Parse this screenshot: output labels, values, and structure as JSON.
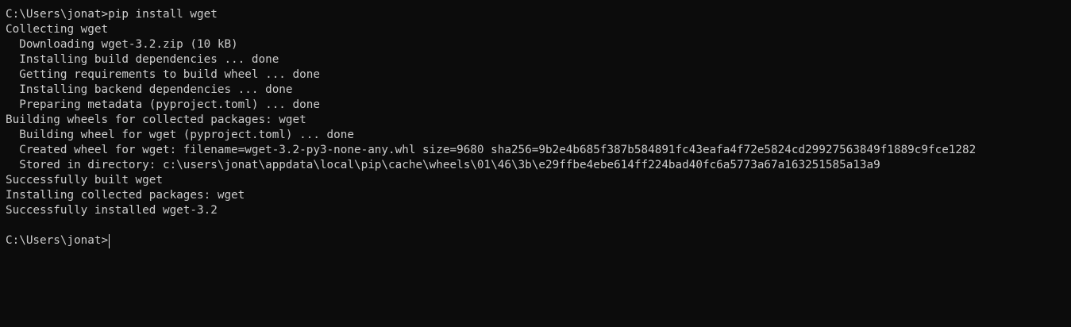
{
  "terminal": {
    "lines": [
      "C:\\Users\\jonat>pip install wget",
      "Collecting wget",
      "  Downloading wget-3.2.zip (10 kB)",
      "  Installing build dependencies ... done",
      "  Getting requirements to build wheel ... done",
      "  Installing backend dependencies ... done",
      "  Preparing metadata (pyproject.toml) ... done",
      "Building wheels for collected packages: wget",
      "  Building wheel for wget (pyproject.toml) ... done",
      "  Created wheel for wget: filename=wget-3.2-py3-none-any.whl size=9680 sha256=9b2e4b685f387b584891fc43eafa4f72e5824cd29927563849f1889c9fce1282",
      "  Stored in directory: c:\\users\\jonat\\appdata\\local\\pip\\cache\\wheels\\01\\46\\3b\\e29ffbe4ebe614ff224bad40fc6a5773a67a163251585a13a9",
      "Successfully built wget",
      "Installing collected packages: wget",
      "Successfully installed wget-3.2",
      ""
    ],
    "prompt": "C:\\Users\\jonat>"
  }
}
